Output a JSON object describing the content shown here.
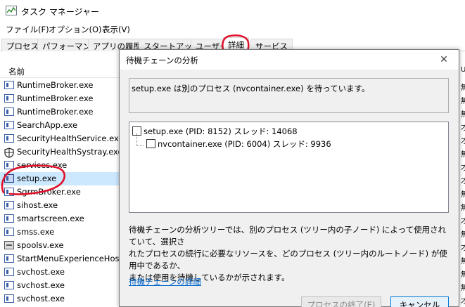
{
  "window": {
    "title": "タスク マネージャー"
  },
  "menu": [
    "ファイル(F)",
    "オプション(O)",
    "表示(V)"
  ],
  "tabs": [
    "プロセス",
    "パフォーマンス",
    "アプリの履歴",
    "スタートアップ",
    "ユーザー",
    "詳細",
    "サービス"
  ],
  "active_tab": "詳細",
  "columns": {
    "name": "名前",
    "right_header": "U"
  },
  "processes": [
    {
      "name": "RuntimeBroker.exe",
      "icon": "window-icon"
    },
    {
      "name": "RuntimeBroker.exe",
      "icon": "window-icon"
    },
    {
      "name": "RuntimeBroker.exe",
      "icon": "window-icon"
    },
    {
      "name": "SearchApp.exe",
      "icon": "window-icon"
    },
    {
      "name": "SecurityHealthService.exe",
      "icon": "window-icon"
    },
    {
      "name": "SecurityHealthSystray.exe",
      "icon": "shield-icon"
    },
    {
      "name": "services.exe",
      "icon": "window-icon"
    },
    {
      "name": "setup.exe",
      "icon": "setup-icon",
      "selected": true
    },
    {
      "name": "SgrmBroker.exe",
      "icon": "window-icon"
    },
    {
      "name": "sihost.exe",
      "icon": "window-icon"
    },
    {
      "name": "smartscreen.exe",
      "icon": "window-icon"
    },
    {
      "name": "smss.exe",
      "icon": "window-icon"
    },
    {
      "name": "spoolsv.exe",
      "icon": "printer-icon"
    },
    {
      "name": "StartMenuExperienceHost.exe",
      "icon": "window-icon"
    },
    {
      "name": "svchost.exe",
      "icon": "window-icon"
    },
    {
      "name": "svchost.exe",
      "icon": "window-icon"
    },
    {
      "name": "svchost.exe",
      "icon": "window-icon"
    }
  ],
  "right_column_glyphs": [
    "無",
    "無",
    "無",
    "才",
    "才",
    "無",
    "才",
    "才",
    "無",
    "無",
    "才",
    "無",
    "才",
    "無",
    "無",
    "無",
    "才"
  ],
  "dialog": {
    "title": "待機チェーンの分析",
    "status": "setup.exe は別のプロセス (nvcontainer.exe) を待っています。",
    "tree": [
      {
        "label": "setup.exe (PID: 8152) スレッド: 14068"
      },
      {
        "label": "nvcontainer.exe (PID: 6004) スレッド: 9936"
      }
    ],
    "description_lines": [
      "待機チェーンの分析ツリーでは、別のプロセス (ツリー内の子ノード) によって使用されていて、選択さ",
      "れたプロセスの続行に必要なリソースを、どのプロセス (ツリー内のルートノード) が使用中であるか、",
      "または使用を待機しているかが示されます。"
    ],
    "link": "待機チェーンの詳細",
    "end_process_button": "プロセスの終了(E)",
    "cancel_button": "キャンセル"
  },
  "colors": {
    "annotation": "#e0102a",
    "link": "#0066cc",
    "selection": "#cce8ff"
  }
}
